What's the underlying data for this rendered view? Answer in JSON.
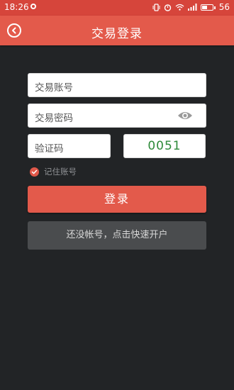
{
  "status_bar": {
    "time": "18:26",
    "battery": "56",
    "battery_level": 0.56
  },
  "header": {
    "title": "交易登录",
    "back_icon": "back-circle-icon"
  },
  "form": {
    "account_placeholder": "交易账号",
    "password_placeholder": "交易密码",
    "captcha_placeholder": "验证码",
    "captcha_value": "0051",
    "remember_label": "记住账号",
    "remember_checked": true
  },
  "buttons": {
    "login_label": "登录",
    "register_label": "还没帐号，点击快速开户"
  },
  "colors": {
    "brand": "#e35a4b",
    "background": "#222426",
    "captcha_text": "#2e8a3a"
  }
}
